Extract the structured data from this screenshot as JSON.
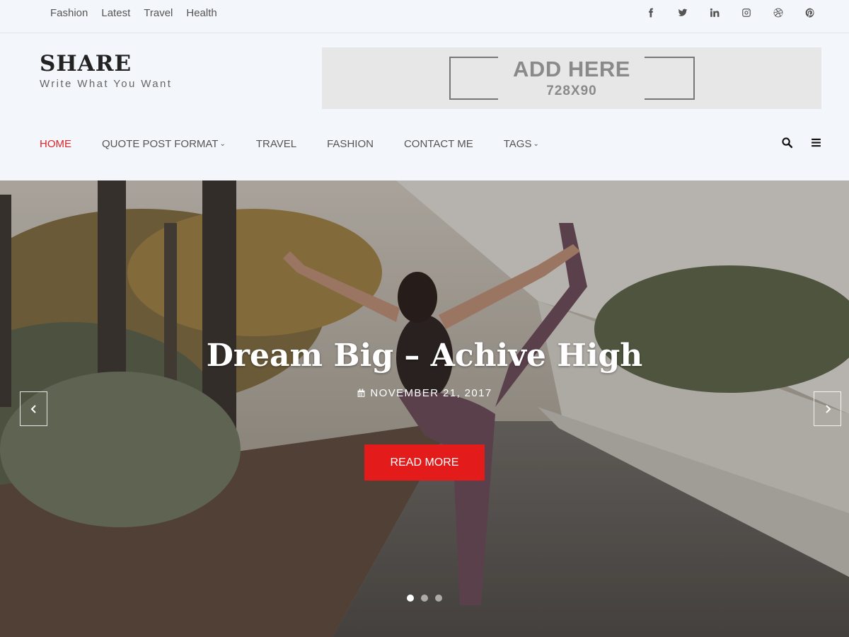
{
  "top_links": [
    "Fashion",
    "Latest",
    "Travel",
    "Health"
  ],
  "socials": [
    "facebook-icon",
    "twitter-icon",
    "linkedin-icon",
    "instagram-icon",
    "dribbble-icon",
    "pinterest-icon"
  ],
  "brand": {
    "title": "SHARE",
    "tagline": "Write What You Want"
  },
  "ad": {
    "main": "ADD HERE",
    "sub": "728X90"
  },
  "nav": [
    {
      "label": "HOME",
      "active": true,
      "dropdown": false
    },
    {
      "label": "QUOTE POST FORMAT",
      "active": false,
      "dropdown": true
    },
    {
      "label": "TRAVEL",
      "active": false,
      "dropdown": false
    },
    {
      "label": "FASHION",
      "active": false,
      "dropdown": false
    },
    {
      "label": "CONTACT ME",
      "active": false,
      "dropdown": false
    },
    {
      "label": "TAGS",
      "active": false,
      "dropdown": true
    }
  ],
  "hero": {
    "title": "Dream Big – Achive High",
    "date": "NOVEMBER 21, 2017",
    "button": "READ MORE",
    "slides": 3,
    "active_slide": 1
  },
  "colors": {
    "accent": "#d9262a",
    "button": "#e31b1b"
  }
}
